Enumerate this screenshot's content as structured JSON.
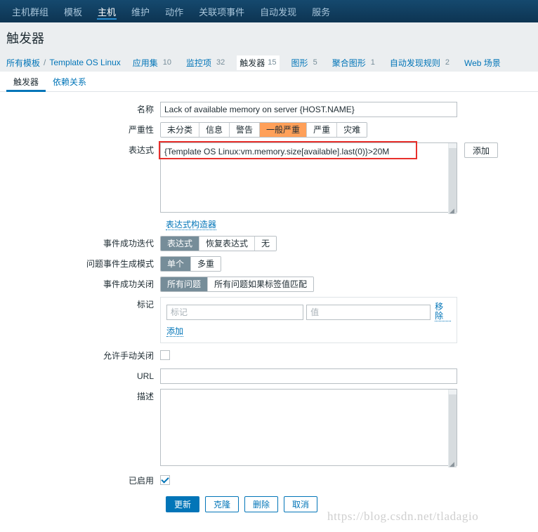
{
  "topnav": {
    "items": [
      {
        "label": "主机群组",
        "active": false
      },
      {
        "label": "模板",
        "active": false
      },
      {
        "label": "主机",
        "active": true
      },
      {
        "label": "维护",
        "active": false
      },
      {
        "label": "动作",
        "active": false
      },
      {
        "label": "关联项事件",
        "active": false
      },
      {
        "label": "自动发现",
        "active": false
      },
      {
        "label": "服务",
        "active": false
      }
    ]
  },
  "page": {
    "title": "触发器"
  },
  "breadcrumb": {
    "root_label": "所有模板",
    "separator": "/",
    "template_label": "Template OS Linux",
    "items": [
      {
        "label": "应用集",
        "count": "10",
        "selected": false
      },
      {
        "label": "监控项",
        "count": "32",
        "selected": false
      },
      {
        "label": "触发器",
        "count": "15",
        "selected": true
      },
      {
        "label": "图形",
        "count": "5",
        "selected": false
      },
      {
        "label": "聚合图形",
        "count": "1",
        "selected": false
      },
      {
        "label": "自动发现规则",
        "count": "2",
        "selected": false
      },
      {
        "label": "Web 场景",
        "count": "",
        "selected": false
      }
    ]
  },
  "subtabs": [
    {
      "label": "触发器",
      "active": true
    },
    {
      "label": "依赖关系",
      "active": false
    }
  ],
  "form": {
    "name": {
      "label": "名称",
      "value": "Lack of available memory on server {HOST.NAME}"
    },
    "severity": {
      "label": "严重性",
      "options": [
        {
          "label": "未分类",
          "state": "normal"
        },
        {
          "label": "信息",
          "state": "normal"
        },
        {
          "label": "警告",
          "state": "normal"
        },
        {
          "label": "一般严重",
          "state": "selected-orange"
        },
        {
          "label": "严重",
          "state": "normal"
        },
        {
          "label": "灾难",
          "state": "normal"
        }
      ]
    },
    "expression": {
      "label": "表达式",
      "value": "{Template OS Linux:vm.memory.size[available].last(0)}>20M",
      "add_button": "添加",
      "builder_link": "表达式构造器"
    },
    "ok_event_generation": {
      "label": "事件成功迭代",
      "options": [
        {
          "label": "表达式",
          "state": "selected-gray"
        },
        {
          "label": "恢复表达式",
          "state": "normal"
        },
        {
          "label": "无",
          "state": "normal"
        }
      ]
    },
    "problem_event_mode": {
      "label": "问题事件生成模式",
      "options": [
        {
          "label": "单个",
          "state": "selected-gray"
        },
        {
          "label": "多重",
          "state": "normal"
        }
      ]
    },
    "ok_event_closes": {
      "label": "事件成功关闭",
      "options": [
        {
          "label": "所有问题",
          "state": "selected-gray"
        },
        {
          "label": "所有问题如果标签值匹配",
          "state": "normal"
        }
      ]
    },
    "tags": {
      "label": "标记",
      "tag_placeholder": "标记",
      "tag_value": "",
      "value_placeholder": "值",
      "value_value": "",
      "remove_label": "移除",
      "add_label": "添加"
    },
    "allow_manual_close": {
      "label": "允许手动关闭",
      "checked": false
    },
    "url": {
      "label": "URL",
      "value": "",
      "placeholder": ""
    },
    "description": {
      "label": "描述",
      "value": ""
    },
    "enabled": {
      "label": "已启用",
      "checked": true
    }
  },
  "footer": {
    "buttons": [
      {
        "label": "更新",
        "primary": true
      },
      {
        "label": "克隆",
        "primary": false
      },
      {
        "label": "删除",
        "primary": false
      },
      {
        "label": "取消",
        "primary": false
      }
    ]
  },
  "watermark": {
    "text": "https://blog.csdn.net/tladagio"
  },
  "colors": {
    "nav_background": "#0e3b5c",
    "accent_blue": "#0275b8",
    "selected_gray": "#768d99",
    "selected_orange": "#ffa059",
    "annotation_red": "#e8302c"
  }
}
